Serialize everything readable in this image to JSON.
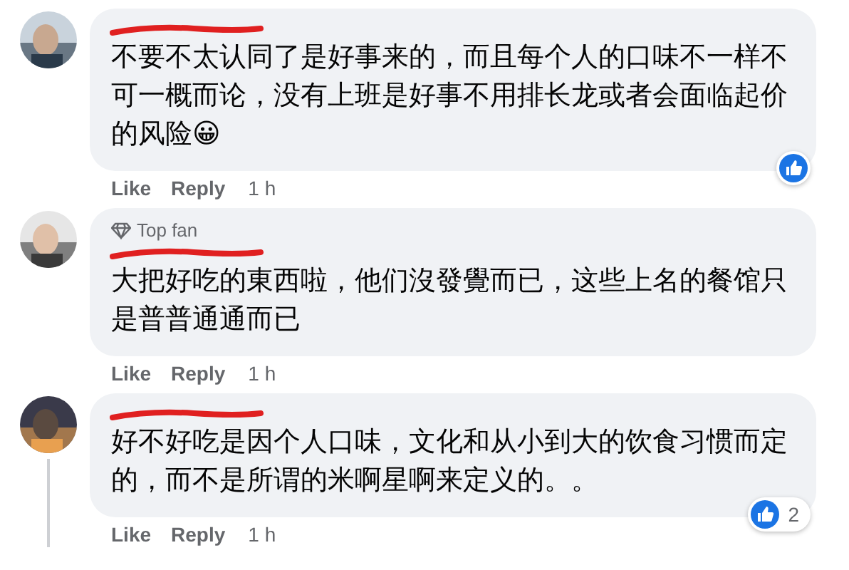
{
  "comments": [
    {
      "text": "不要不太认同了是好事来的，而且每个人的口味不一样不可一概而论，没有上班是好事不用排长龙或者会面临起价的风险😀",
      "actions": [
        "Like",
        "Reply"
      ],
      "time": "1 h",
      "reactions": {
        "kind": "like"
      },
      "thread_line": false
    },
    {
      "badge": "Top fan",
      "text": "大把好吃的東西啦，他们沒發覺而已，这些上名的餐馆只是普普通通而已",
      "actions": [
        "Like",
        "Reply"
      ],
      "time": "1 h",
      "thread_line": false
    },
    {
      "text": "好不好吃是因个人口味，文化和从小到大的饮食习惯而定的，而不是所谓的米啊星啊来定义的。。",
      "actions": [
        "Like",
        "Reply"
      ],
      "time": "1 h",
      "reactions": {
        "kind": "like",
        "count": "2"
      },
      "thread_line": true
    }
  ]
}
